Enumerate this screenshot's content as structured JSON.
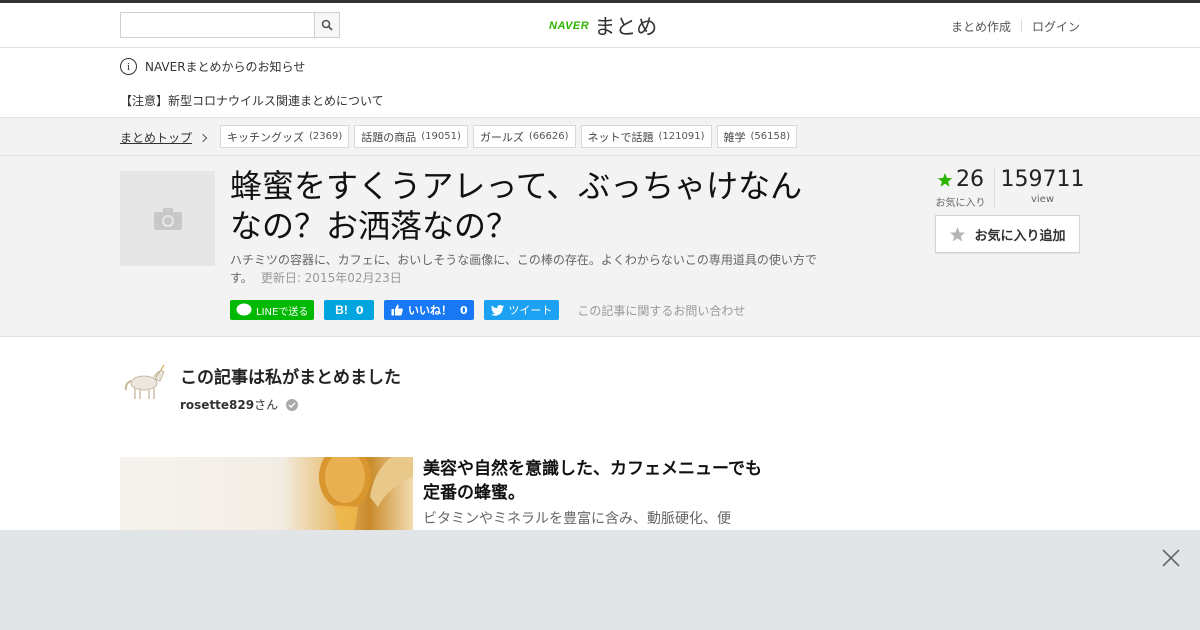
{
  "header": {
    "search_placeholder": "",
    "logo_brand": "NAVER",
    "logo_text": "まとめ",
    "links": [
      "まとめ作成",
      "ログイン"
    ]
  },
  "notice": {
    "title": "NAVERまとめからのお知らせ",
    "message": "【注意】新型コロナウイルス関連まとめについて"
  },
  "breadcrumb": {
    "top": "まとめトップ",
    "tags": [
      {
        "label": "キッチングッズ",
        "count": "(2369)"
      },
      {
        "label": "話題の商品",
        "count": "(19051)"
      },
      {
        "label": "ガールズ",
        "count": "(66626)"
      },
      {
        "label": "ネットで話題",
        "count": "(121091)"
      },
      {
        "label": "雑学",
        "count": "(56158)"
      }
    ]
  },
  "article": {
    "title": "蜂蜜をすくうアレって、ぶっちゃけなんなの？お洒落なの？",
    "description": "ハチミツの容器に、カフェに、おいしそうな画像に、この棒の存在。よくわからないこの専用道具の使い方です。",
    "updated": "更新日: 2015年02月23日",
    "social": {
      "line": "LINEで送る",
      "hatena_count": "0",
      "fb_label": "いいね！",
      "fb_count": "0",
      "tweet": "ツイート"
    },
    "contact": "この記事に関するお問い合わせ",
    "favorites": "26",
    "favorites_label": "お気に入り",
    "views": "159711",
    "views_label": "view",
    "fav_button": "お気に入り追加"
  },
  "author": {
    "heading": "この記事は私がまとめました",
    "name": "rosette829",
    "suffix": "さん"
  },
  "item": {
    "heading": "美容や自然を意識した、カフェメニューでも定番の蜂蜜。",
    "text": "ビタミンやミネラルを豊富に含み、動脈硬化、便"
  },
  "colors": {
    "naver_green": "#2db400",
    "line_green": "#00b900",
    "hatena_blue": "#00a4de",
    "facebook_blue": "#1877f2",
    "twitter_blue": "#1da1f2",
    "star_green": "#2db400"
  }
}
